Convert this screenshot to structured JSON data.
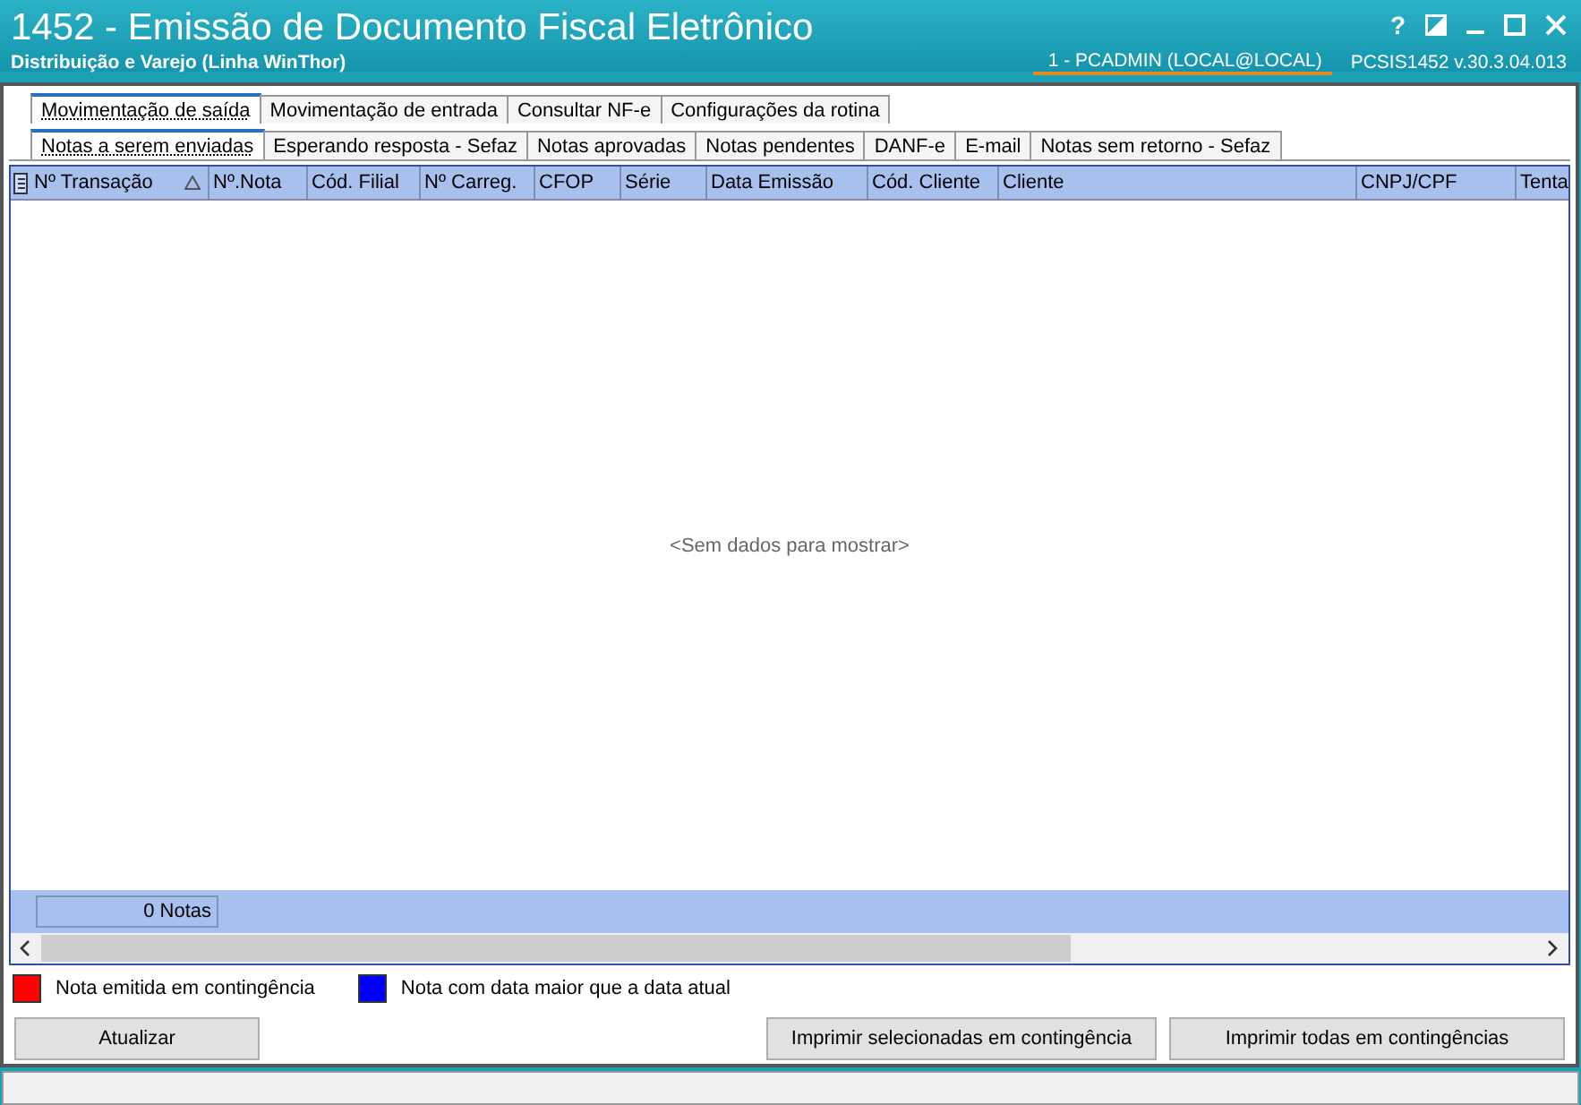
{
  "window": {
    "title": "1452 - Emissão de Documento Fiscal Eletrônico",
    "subtitle": "Distribuição e Varejo (Linha WinThor)",
    "user": "1 - PCADMIN (LOCAL@LOCAL)",
    "version": "PCSIS1452  v.30.3.04.013",
    "controls": [
      "?"
    ]
  },
  "tabs": [
    {
      "label": "Movimentação de saída",
      "selected": true
    },
    {
      "label": "Movimentação de entrada",
      "selected": false
    },
    {
      "label": "Consultar NF-e",
      "selected": false
    },
    {
      "label": "Configurações da rotina",
      "selected": false
    }
  ],
  "subtabs": [
    {
      "label": "Notas a serem enviadas",
      "selected": true
    },
    {
      "label": "Esperando resposta - Sefaz",
      "selected": false
    },
    {
      "label": "Notas aprovadas",
      "selected": false
    },
    {
      "label": "Notas pendentes",
      "selected": false
    },
    {
      "label": "DANF-e",
      "selected": false
    },
    {
      "label": "E-mail",
      "selected": false
    },
    {
      "label": "Notas sem retorno - Sefaz",
      "selected": false
    }
  ],
  "table": {
    "columns": [
      {
        "label": "Nº Transação",
        "sorted": true
      },
      {
        "label": "Nº.Nota",
        "sorted": false
      },
      {
        "label": "Cód. Filial",
        "sorted": false
      },
      {
        "label": "Nº Carreg.",
        "sorted": false
      },
      {
        "label": "CFOP",
        "sorted": false
      },
      {
        "label": "Série",
        "sorted": false
      },
      {
        "label": "Data Emissão",
        "sorted": false
      },
      {
        "label": "Cód. Cliente",
        "sorted": false
      },
      {
        "label": "Cliente",
        "sorted": false
      },
      {
        "label": "CNPJ/CPF",
        "sorted": false
      },
      {
        "label": "Tenta",
        "sorted": false
      }
    ],
    "empty_message": "<Sem dados para mostrar>",
    "footer_count": "0 Notas"
  },
  "legend": [
    {
      "label": "Nota emitida em contingência",
      "color": "#ff0000"
    },
    {
      "label": "Nota com data maior que a data atual",
      "color": "#0000ff"
    }
  ],
  "buttons": [
    "Atualizar",
    "Imprimir selecionadas em contingência",
    "Imprimir todas em contingências"
  ]
}
